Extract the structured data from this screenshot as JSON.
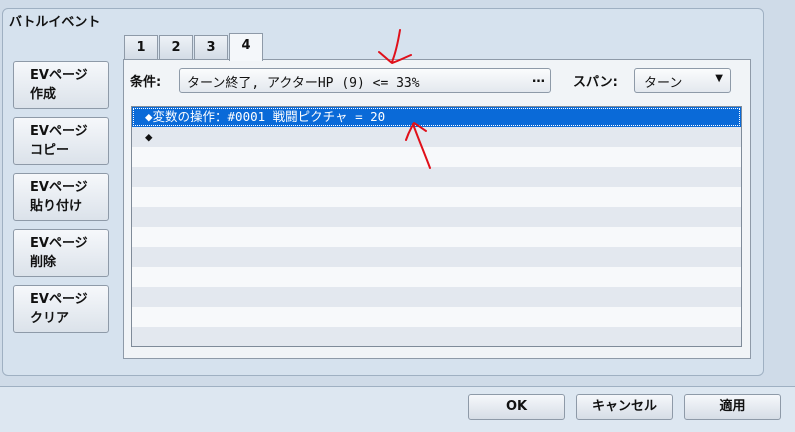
{
  "group": {
    "title": "バトルイベント"
  },
  "side_buttons": [
    {
      "line1": "EVページ",
      "line2": "作成"
    },
    {
      "line1": "EVページ",
      "line2": "コピー"
    },
    {
      "line1": "EVページ",
      "line2": "貼り付け"
    },
    {
      "line1": "EVページ",
      "line2": "削除"
    },
    {
      "line1": "EVページ",
      "line2": "クリア"
    }
  ],
  "tabs": [
    "1",
    "2",
    "3",
    "4"
  ],
  "active_tab": "4",
  "condition": {
    "label": "条件:",
    "value": "ターン終了, アクターHP (9) <= 33%",
    "dots": "…"
  },
  "span": {
    "label": "スパン:",
    "value": "ターン",
    "chevron_icon": "chevron-down-icon"
  },
  "commands": [
    "◆変数の操作：#0001 戦闘ピクチャ = 20",
    "◆"
  ],
  "footer": {
    "ok_label": "OK",
    "cancel_label": "キャンセル",
    "apply_label": "適用"
  },
  "colors": {
    "selection": "#0a6ad8",
    "annotation": "#e0101a"
  }
}
